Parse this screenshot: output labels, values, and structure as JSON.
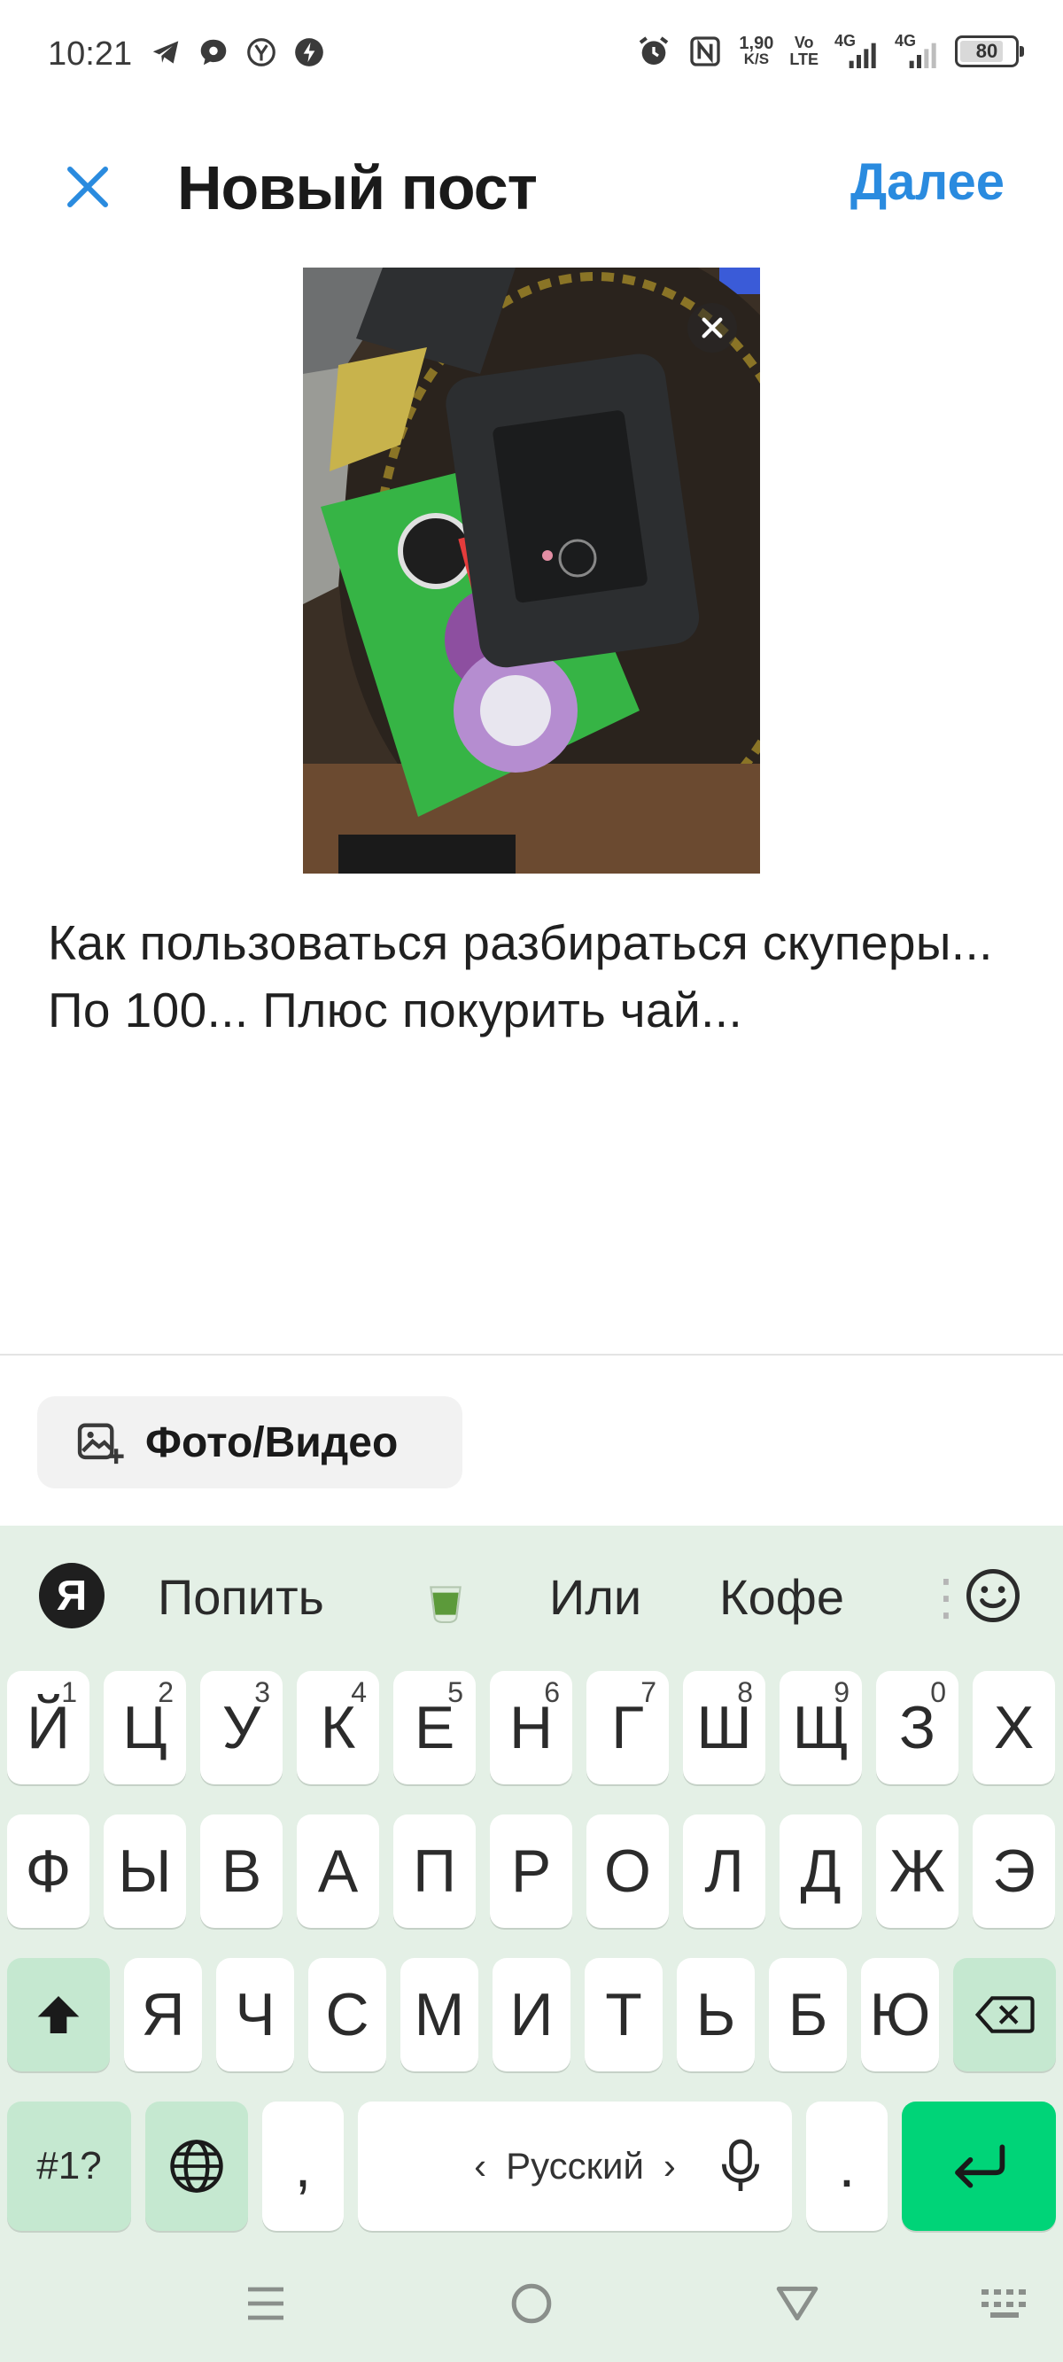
{
  "status_bar": {
    "time": "10:21",
    "speed_value": "1,90",
    "speed_unit": "K/S",
    "volte_top": "Vo",
    "volte_bottom": "LTE",
    "net1": "4G",
    "net2": "4G",
    "battery": "80"
  },
  "header": {
    "title": "Новый пост",
    "next_label": "Далее"
  },
  "caption": "Как пользоваться разбираться скуперы... По 100... Плюс покурить чай...",
  "media_button": {
    "label": "Фото/Видео"
  },
  "keyboard": {
    "logo": "Я",
    "suggestions": [
      "Попить",
      "Или",
      "Кофе"
    ],
    "row1": [
      {
        "key": "Й",
        "hint": "1"
      },
      {
        "key": "Ц",
        "hint": "2"
      },
      {
        "key": "У",
        "hint": "3"
      },
      {
        "key": "К",
        "hint": "4"
      },
      {
        "key": "Е",
        "hint": "5"
      },
      {
        "key": "Н",
        "hint": "6"
      },
      {
        "key": "Г",
        "hint": "7"
      },
      {
        "key": "Ш",
        "hint": "8"
      },
      {
        "key": "Щ",
        "hint": "9"
      },
      {
        "key": "З",
        "hint": "0"
      },
      {
        "key": "Х",
        "hint": ""
      }
    ],
    "row2": [
      "Ф",
      "Ы",
      "В",
      "А",
      "П",
      "Р",
      "О",
      "Л",
      "Д",
      "Ж",
      "Э"
    ],
    "row3": [
      "Я",
      "Ч",
      "С",
      "М",
      "И",
      "Т",
      "Ь",
      "Б",
      "Ю"
    ],
    "symbols_label": "#1?",
    "comma": ",",
    "period": ".",
    "space_label": "Русский"
  },
  "colors": {
    "accent": "#2a8bdf",
    "keyboard_bg": "#e4f0e6",
    "func_key": "#c5e8d0",
    "enter_key": "#00d478"
  }
}
